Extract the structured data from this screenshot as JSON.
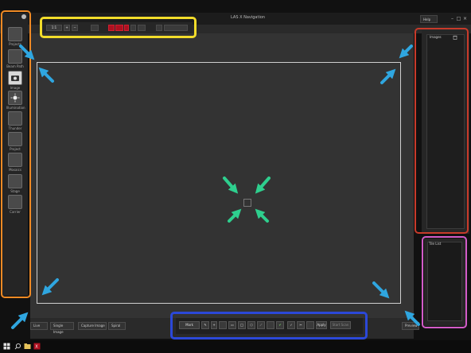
{
  "window": {
    "title": "LAS X Navigation",
    "help_label": "Help"
  },
  "toolbar": {
    "zoom_label": "1:1"
  },
  "left_tools": [
    {
      "label": "Projects",
      "icon": "projects-icon"
    },
    {
      "label": "Beam Path",
      "icon": "beam-path-icon"
    },
    {
      "label": "Image",
      "icon": "camera-icon",
      "active": true
    },
    {
      "label": "Illumination",
      "icon": "illumination-icon"
    },
    {
      "label": "Thunder",
      "icon": "thunder-icon"
    },
    {
      "label": "Project",
      "icon": "project-icon"
    },
    {
      "label": "Mosaics",
      "icon": "mosaic-icon"
    },
    {
      "label": "Stage",
      "icon": "stage-icon"
    },
    {
      "label": "Carrier",
      "icon": "carrier-icon"
    }
  ],
  "images_panel": {
    "title": "Images"
  },
  "pink_panel": {
    "title": "Tile List"
  },
  "bottom": {
    "live": "Live",
    "single_image": "Single Image",
    "capture_image": "Capture Image",
    "spiral": "Spiral",
    "mark": "Mark",
    "apply": "Apply",
    "start_scan": "Start Scan",
    "preview": "Preview"
  },
  "highlight_colors": {
    "orange": "#f08a24",
    "yellow": "#f2dc2a",
    "red": "#c83a2a",
    "pink": "#d25cc8",
    "blue": "#2b48d8",
    "arrow_blue": "#2fa6e0",
    "arrow_green": "#2ecf8e"
  }
}
